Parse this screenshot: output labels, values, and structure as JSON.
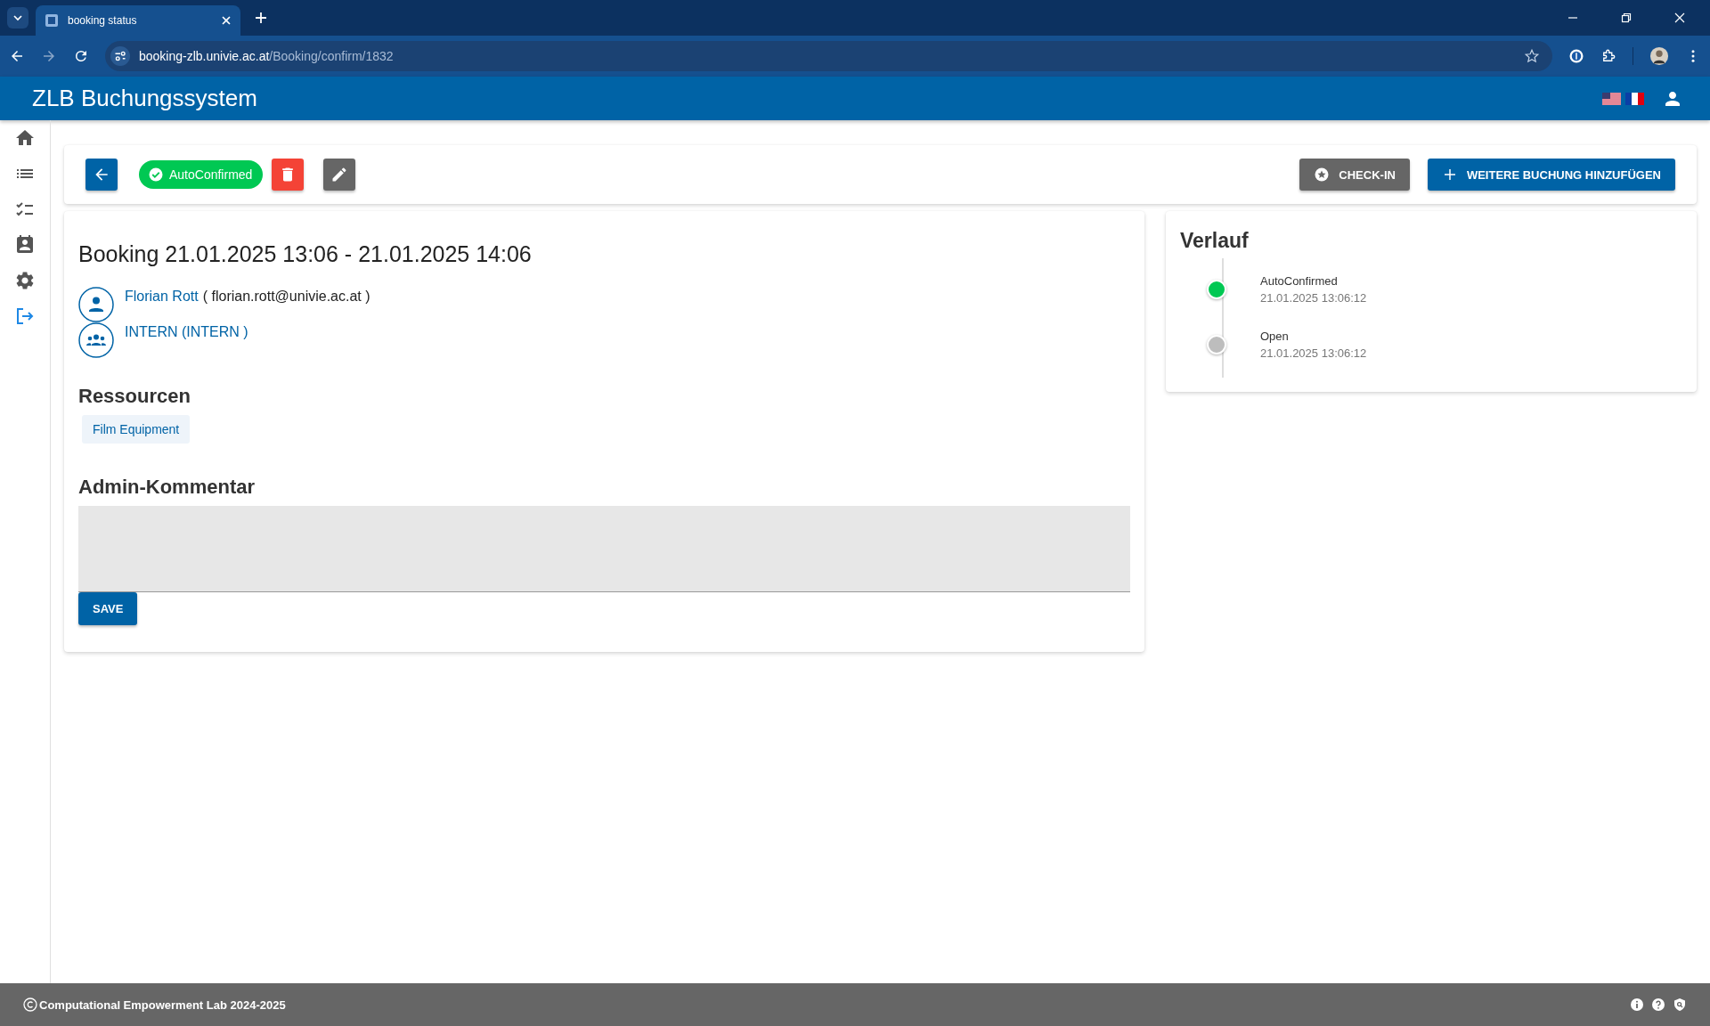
{
  "browser": {
    "tab_title": "booking status",
    "url_host": "booking-zlb.univie.ac.at",
    "url_path": "/Booking/confirm/1832"
  },
  "header": {
    "title": "ZLB Buchungssystem"
  },
  "toolbar": {
    "status": "AutoConfirmed",
    "buttons": [
      {
        "label": "CHECK-IN",
        "kind": "checkin"
      },
      {
        "label": "WEITERE BUCHUNG HINZUFÜGEN",
        "kind": "add"
      }
    ]
  },
  "booking": {
    "title": "Booking 21.01.2025 13:06 - 21.01.2025 14:06",
    "user_name": "Florian Rott",
    "user_email": "( florian.rott@univie.ac.at )",
    "group": "INTERN (INTERN )"
  },
  "resources": {
    "heading": "Ressourcen",
    "items": [
      "Film Equipment"
    ]
  },
  "comment": {
    "heading": "Admin-Kommentar",
    "save": "SAVE"
  },
  "history": {
    "title": "Verlauf",
    "items": [
      {
        "status": "AutoConfirmed",
        "time": "21.01.2025 13:06:12",
        "color": "#00c853"
      },
      {
        "status": "Open",
        "time": "21.01.2025 13:06:12",
        "color": "#bdbdbd"
      }
    ]
  },
  "footer": {
    "text": "Computational Empowerment Lab 2024-2025"
  }
}
